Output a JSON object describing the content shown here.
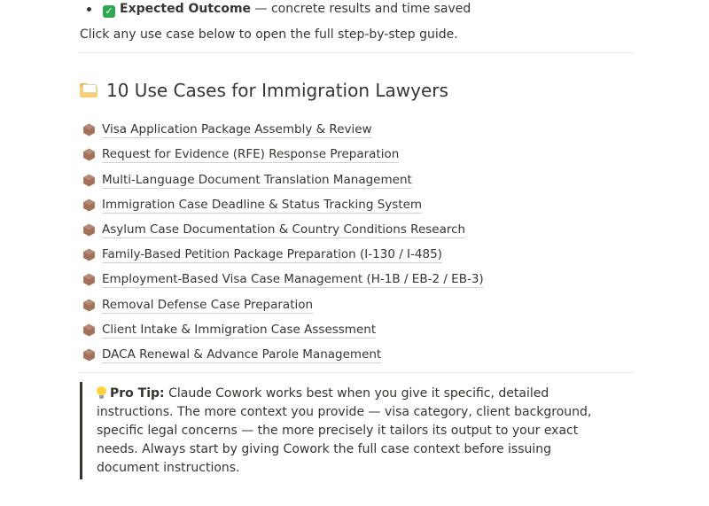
{
  "intro": {
    "bullet": {
      "icon": "check-mark-icon",
      "label": "Expected Outcome",
      "text": " — concrete results and time saved"
    },
    "instruction": "Click any use case below to open the full step-by-step guide."
  },
  "section": {
    "icon": "folder-icon",
    "title": "10 Use Cases for Immigration Lawyers",
    "item_icon": "hexagon-icon",
    "item_icon_color": "#a3705a",
    "items": [
      "Visa Application Package Assembly & Review",
      "Request for Evidence (RFE) Response Preparation",
      "Multi-Language Document Translation Management",
      "Immigration Case Deadline & Status Tracking System",
      "Asylum Case Documentation & Country Conditions Research",
      "Family-Based Petition Package Preparation (I-130 / I-485)",
      "Employment-Based Visa Case Management (H-1B / EB-2 / EB-3)",
      "Removal Defense Case Preparation",
      "Client Intake & Immigration Case Assessment",
      "DACA Renewal & Advance Parole Management"
    ]
  },
  "tip": {
    "icon": "light-bulb-icon",
    "label": "Pro Tip:",
    "text": " Claude Cowork works best when you give it specific, detailed instructions. The more context you provide — visa category, client background, specific legal concerns — the more precisely it tailors its output to your exact needs. Always start by giving Cowork the full case context before issuing document instructions."
  }
}
